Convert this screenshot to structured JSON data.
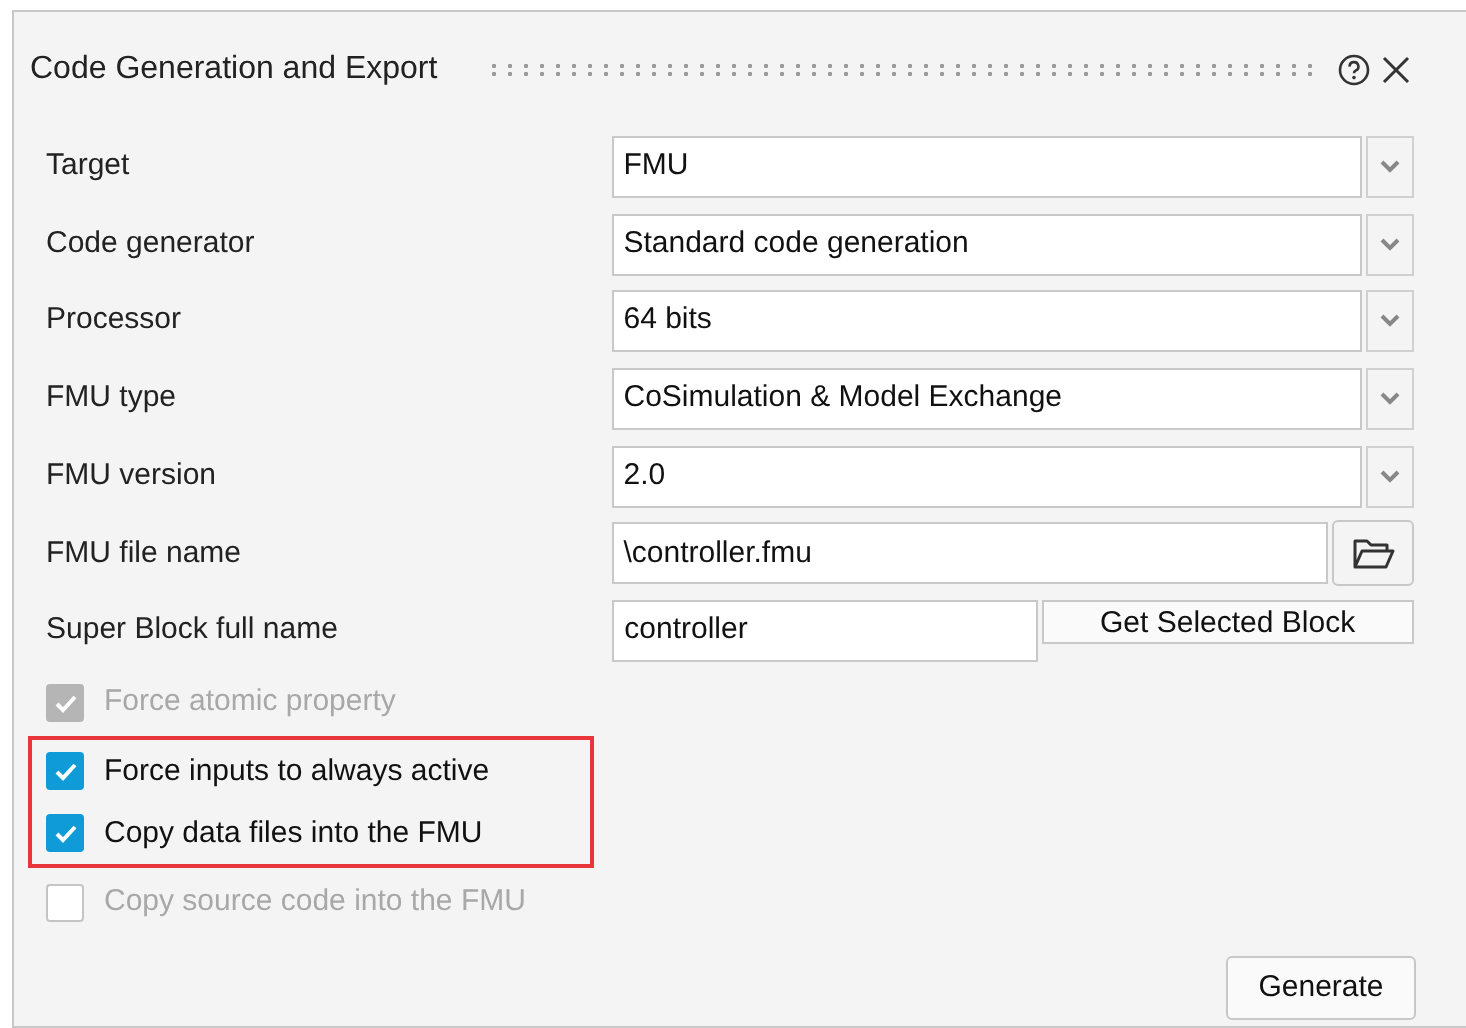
{
  "panel": {
    "title": "Code Generation and Export"
  },
  "fields": [
    {
      "kind": "dropdown",
      "label": "Target",
      "value": "FMU"
    },
    {
      "kind": "dropdown",
      "label": "Code generator",
      "value": "Standard code generation"
    },
    {
      "kind": "dropdown",
      "label": "Processor",
      "value": "64 bits"
    },
    {
      "kind": "dropdown",
      "label": "FMU type",
      "value": "CoSimulation & Model Exchange"
    },
    {
      "kind": "dropdown",
      "label": "FMU version",
      "value": "2.0"
    },
    {
      "kind": "file",
      "label": "FMU file name",
      "value": "\\controller.fmu"
    },
    {
      "kind": "block",
      "label": "Super Block full name",
      "value": "controller",
      "button": "Get Selected Block"
    }
  ],
  "options": [
    {
      "label": "Force atomic property",
      "checked": true,
      "disabled": true,
      "highlighted": false
    },
    {
      "label": "Force inputs to always active",
      "checked": true,
      "disabled": false,
      "highlighted": true
    },
    {
      "label": "Copy data files into the FMU",
      "checked": true,
      "disabled": false,
      "highlighted": true
    },
    {
      "label": "Copy source code into the FMU",
      "checked": false,
      "disabled": true,
      "highlighted": false
    }
  ],
  "buttons": [
    "Generate"
  ]
}
